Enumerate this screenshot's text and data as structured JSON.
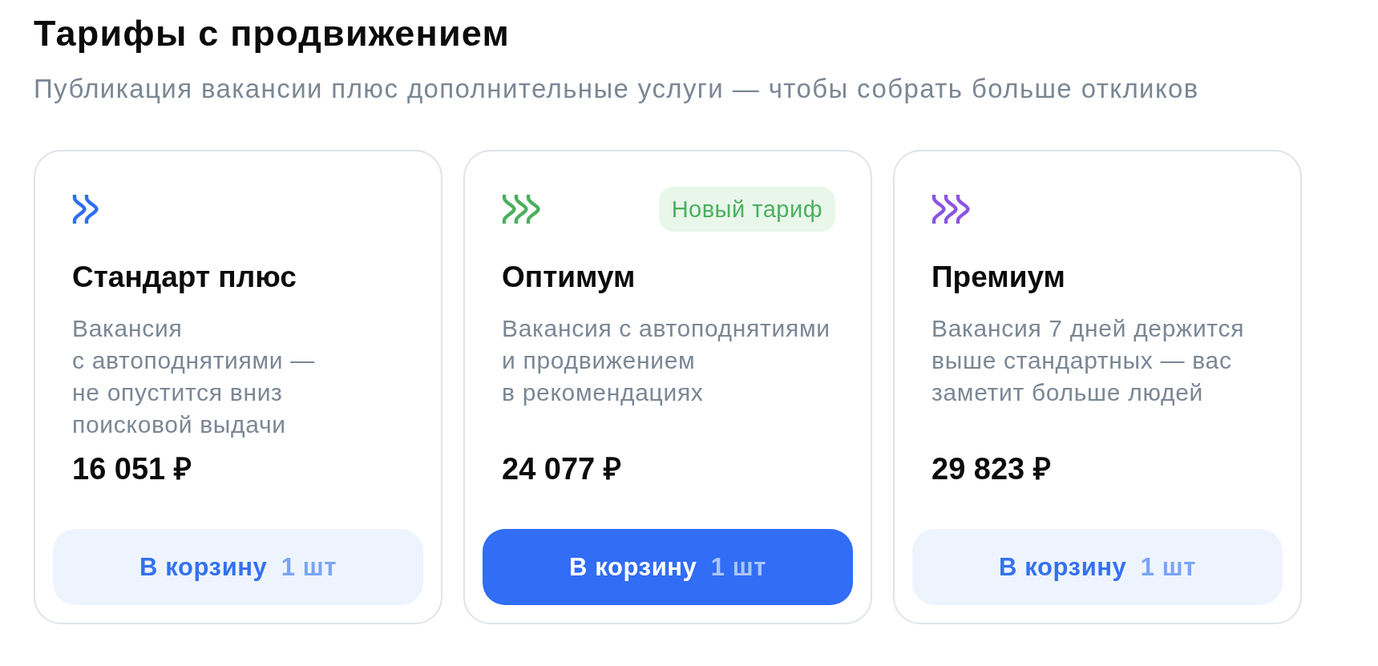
{
  "heading": {
    "title": "Тарифы с продвижением",
    "subtitle": "Публикация вакансии плюс дополнительные услуги — чтобы собрать больше откликов"
  },
  "plans": [
    {
      "icon": {
        "kind": "double-chevron",
        "color": "#2f6ef2"
      },
      "name": "Стандарт плюс",
      "description": "Вакансия\nс автоподнятиями —\nне опустится вниз\nпоисковой выдачи",
      "price": "16 051 ₽",
      "button": {
        "label": "В корзину",
        "quantity": "1 шт",
        "primary": false
      }
    },
    {
      "icon": {
        "kind": "triple-chevron",
        "color": "#4caf5f"
      },
      "badge": "Новый тариф",
      "name": "Оптимум",
      "description": "Вакансия с автоподнятиями\nи продвижением\nв рекомендациях",
      "price": "24 077 ₽",
      "button": {
        "label": "В корзину",
        "quantity": "1 шт",
        "primary": true
      }
    },
    {
      "icon": {
        "kind": "triple-chevron",
        "color": "#8a55e2"
      },
      "name": "Премиум",
      "description": "Вакансия 7 дней держится\nвыше стандартных — вас\nзаметит больше людей",
      "price": "29 823 ₽",
      "button": {
        "label": "В корзину",
        "quantity": "1 шт",
        "primary": false
      }
    }
  ]
}
